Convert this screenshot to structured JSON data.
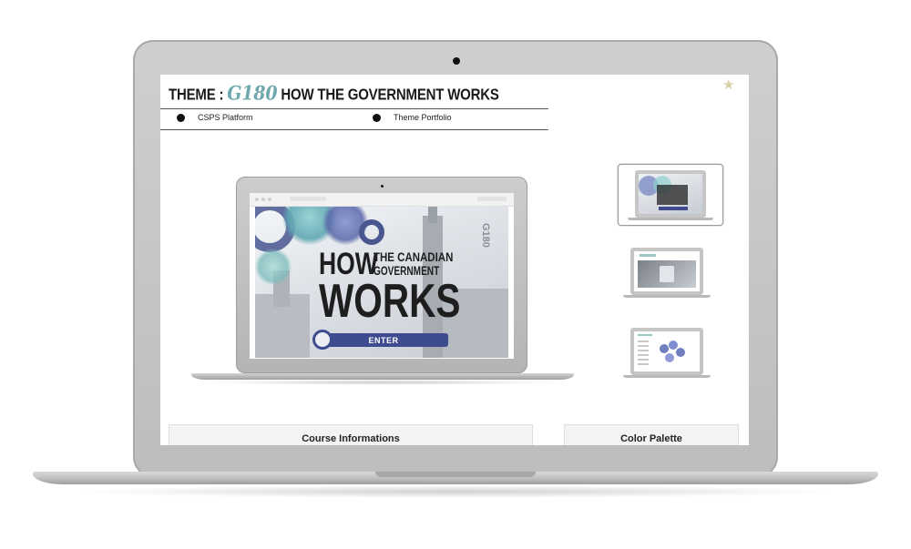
{
  "header": {
    "theme_label": "THEME :",
    "theme_code": "G180",
    "theme_title": "HOW THE GOVERNMENT WORKS"
  },
  "nav": {
    "items": [
      {
        "label": "CSPS Platform"
      },
      {
        "label": "Theme Portfolio"
      }
    ]
  },
  "preview": {
    "hero_how": "HOW",
    "hero_the_canadian": "THE CANADIAN",
    "hero_government": "GOVERNMENT",
    "hero_works": "WORKS",
    "side_code": "G180",
    "enter_label": "ENTER"
  },
  "thumbnails": [
    {
      "name": "Home screen",
      "selected": true
    },
    {
      "name": "Video screen",
      "selected": false
    },
    {
      "name": "Diagram screen",
      "selected": false
    }
  ],
  "panels": {
    "course_info_label": "Course Informations",
    "color_palette_label": "Color Palette"
  },
  "colors": {
    "accent_teal": "#6fa9ad",
    "enter_blue": "#3f4b8f",
    "bezel": "#c4c4c4"
  },
  "icons": {
    "favorite": "star-icon"
  }
}
